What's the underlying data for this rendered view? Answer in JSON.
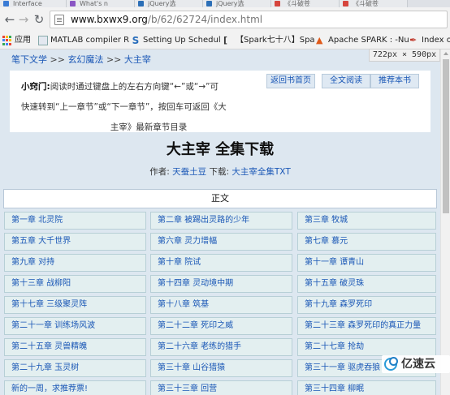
{
  "browser": {
    "tabs": [
      {
        "title": "Interface",
        "fav_color": "#3a7bd5"
      },
      {
        "title": "What's n",
        "fav_color": "#8a56c4"
      },
      {
        "title": "jQuery选",
        "fav_color": "#2c6fb7"
      },
      {
        "title": "jQuery选",
        "fav_color": "#2c6fb7"
      },
      {
        "title": "《斗破苍",
        "fav_color": "#d6453d"
      },
      {
        "title": "《斗破苍",
        "fav_color": "#d6453d"
      }
    ],
    "url_host": "www.bxwx9.org",
    "url_path": "/b/62/62724/index.html",
    "bookmarks": [
      {
        "label": "应用",
        "icon": "apps-icon"
      },
      {
        "label": "MATLAB compiler R",
        "icon": "matlab-icon",
        "color": "#1f5fa8"
      },
      {
        "label": "Setting Up Schedul",
        "icon": "s-icon",
        "color": "#2a6ebb"
      },
      {
        "label": "【Spark七十八】Spa",
        "icon": "bracket-icon",
        "color": "#333333"
      },
      {
        "label": "Apache SPARK : -Nu",
        "icon": "pin-icon",
        "color": "#e05a1a"
      },
      {
        "label": "Index o",
        "icon": "pen-icon",
        "color": "#c0392b"
      }
    ]
  },
  "size_badge": "722px × 590px",
  "breadcrumb": {
    "items": [
      "笔下文学",
      "玄幻魔法",
      "大主宰"
    ],
    "separator": ">>"
  },
  "tip": {
    "label": "小窍门:",
    "line1": "阅读时通过键盘上的左右方向键“←”或“→”可",
    "line2": "快速转到“上一章节”或“下一章节”，按回车可返回《大",
    "line3": "主宰》最新章节目录"
  },
  "actions": {
    "back_to_cover": "返回书首页",
    "full_read": "全文阅读",
    "recommend": "推荐本书"
  },
  "book": {
    "title": "大主宰  全集下载",
    "author_label": "作者:",
    "author": "天蚕土豆",
    "download_label": "下载:",
    "download_link": "大主宰全集TXT"
  },
  "toc": {
    "header": "正文",
    "chapters": [
      "第一章 北灵院",
      "第二章 被踢出灵路的少年",
      "第三章 牧城",
      "第五章 大千世界",
      "第六章 灵力增幅",
      "第七章 慕元",
      "第九章 对持",
      "第十章 院试",
      "第十一章 谭青山",
      "第十三章 战柳阳",
      "第十四章 灵动境中期",
      "第十五章 破灵珠",
      "第十七章 三级聚灵阵",
      "第十八章 筑基",
      "第十九章 森罗死印",
      "第二十一章 训练场风波",
      "第二十二章 死印之威",
      "第二十三章 森罗死印的真正力量",
      "第二十五章 灵兽精魄",
      "第二十六章 老练的猎手",
      "第二十七章 抢劫",
      "第二十九章 玉灵树",
      "第三十章 山谷猎猿",
      "第三十一章 驱虎吞狼",
      "新的一周，求推荐票!",
      "第三十三章 回营",
      "第三十四章 柳眠"
    ]
  },
  "watermark": "亿速云"
}
